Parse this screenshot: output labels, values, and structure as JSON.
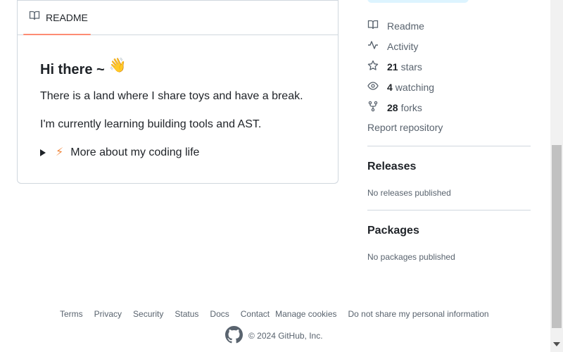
{
  "readme": {
    "tab_label": "README",
    "title": "Hi there ~",
    "wave_emoji": "👋",
    "paragraph1": "There is a land where I share toys and have a break.",
    "paragraph2": "I'm currently learning building tools and AST.",
    "details_label": "More about my coding life",
    "details_icon": "⚡"
  },
  "sidebar": {
    "readme_label": "Readme",
    "activity_label": "Activity",
    "stars_count": "21",
    "stars_label": "stars",
    "watching_count": "4",
    "watching_label": "watching",
    "forks_count": "28",
    "forks_label": "forks",
    "report_label": "Report repository",
    "releases_heading": "Releases",
    "releases_note": "No releases published",
    "packages_heading": "Packages",
    "packages_note": "No packages published"
  },
  "footer": {
    "links": [
      "Terms",
      "Privacy",
      "Security",
      "Status",
      "Docs",
      "Contact",
      "Manage cookies",
      "Do not share my personal information"
    ],
    "copyright": "© 2024 GitHub, Inc."
  },
  "colors": {
    "accent_tab_underline": "#fd8c73",
    "muted_text": "#59636e",
    "border": "#d0d7de",
    "bolt": "#f0883e"
  }
}
